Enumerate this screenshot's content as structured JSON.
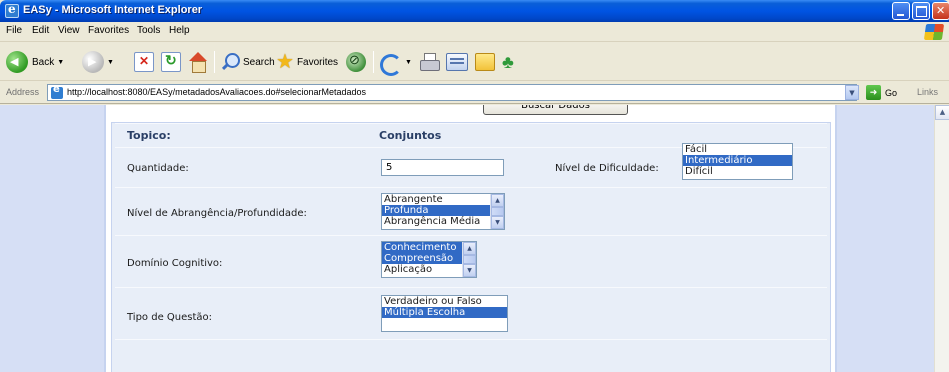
{
  "window": {
    "title": "EASy - Microsoft Internet Explorer"
  },
  "menu": [
    "File",
    "Edit",
    "View",
    "Favorites",
    "Tools",
    "Help"
  ],
  "toolbar": {
    "back_label": "Back",
    "search_label": "Search",
    "favorites_label": "Favorites"
  },
  "address": {
    "label": "Address",
    "url": "http://localhost:8080/EASy/metadadosAvaliacoes.do#selecionarMetadados",
    "go_label": "Go",
    "links_label": "Links"
  },
  "page": {
    "busca_button": "Buscar Dados",
    "topico_label": "Topico:",
    "topico_value": "Conjuntos",
    "quantidade_label": "Quantidade:",
    "quantidade_value": "5",
    "dificuldade_label": "Nível de Dificuldade:",
    "dificuldade_options": [
      {
        "label": "Fácil",
        "selected": false
      },
      {
        "label": "Intermediário",
        "selected": true
      },
      {
        "label": "Difícil",
        "selected": false
      }
    ],
    "abrangencia_label": "Nível de Abrangência/Profundidade:",
    "abrangencia_options": [
      {
        "label": "Abrangente",
        "selected": false
      },
      {
        "label": "Profunda",
        "selected": true
      },
      {
        "label": "Abrangência Média",
        "selected": false
      }
    ],
    "dominio_label": "Domínio Cognitivo:",
    "dominio_options": [
      {
        "label": "Conhecimento",
        "selected": true
      },
      {
        "label": "Compreensão",
        "selected": true
      },
      {
        "label": "Aplicação",
        "selected": false
      }
    ],
    "tipo_label": "Tipo de Questão:",
    "tipo_options": [
      {
        "label": "Verdadeiro ou Falso",
        "selected": false
      },
      {
        "label": "Múltipla Escolha",
        "selected": true
      }
    ]
  },
  "colors": {
    "selection": "#316ac5",
    "panel": "#e8eef8",
    "background": "#d6dff5"
  }
}
